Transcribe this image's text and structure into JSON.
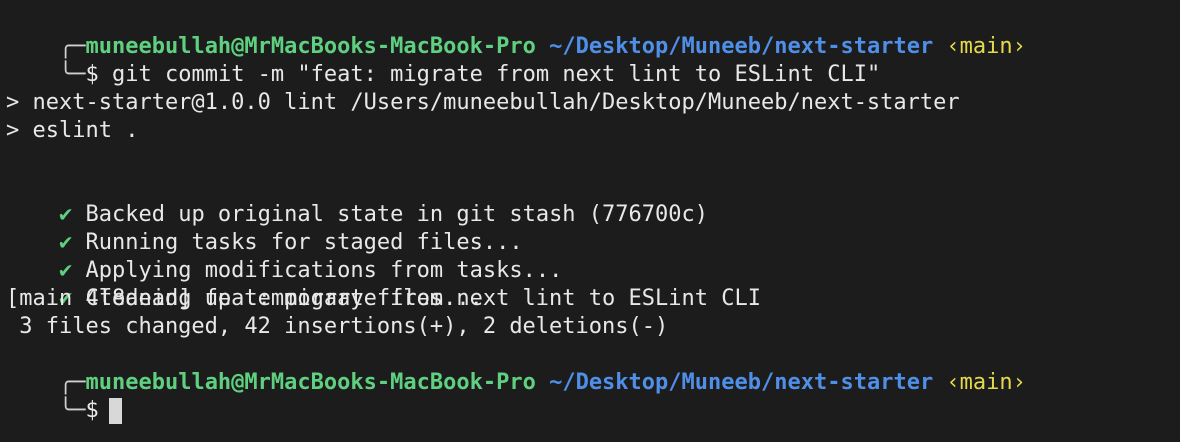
{
  "prompt1": {
    "box_top": "╭─",
    "user": "muneebullah@MrMacBooks-MacBook-Pro",
    "path": "~/Desktop/Muneeb/next-starter",
    "branch": "‹main›",
    "box_bottom": "╰─",
    "symbol": "$",
    "command": "git commit -m \"feat: migrate from next lint to ESLint CLI\""
  },
  "lint": {
    "line1": "> next-starter@1.0.0 lint /Users/muneebullah/Desktop/Muneeb/next-starter",
    "line2": "> eslint ."
  },
  "tasks": [
    {
      "icon": "✔",
      "text": "Backed up original state in git stash (776700c)"
    },
    {
      "icon": "✔",
      "text": "Running tasks for staged files..."
    },
    {
      "icon": "✔",
      "text": "Applying modifications from tasks..."
    },
    {
      "icon": "✔",
      "text": "Cleaning up temporary files..."
    }
  ],
  "commit": {
    "summary": "[main 4f8dead] feat: migrate from next lint to ESLint CLI",
    "stats": " 3 files changed, 42 insertions(+), 2 deletions(-)"
  },
  "prompt2": {
    "box_top": "╭─",
    "user": "muneebullah@MrMacBooks-MacBook-Pro",
    "path": "~/Desktop/Muneeb/next-starter",
    "branch": "‹main›",
    "box_bottom": "╰─",
    "symbol": "$"
  },
  "colors": {
    "background": "#1c1c1c",
    "user": "#5fcf80",
    "path": "#4f8fe8",
    "branch": "#e6d94a",
    "text": "#e8e8e8"
  }
}
